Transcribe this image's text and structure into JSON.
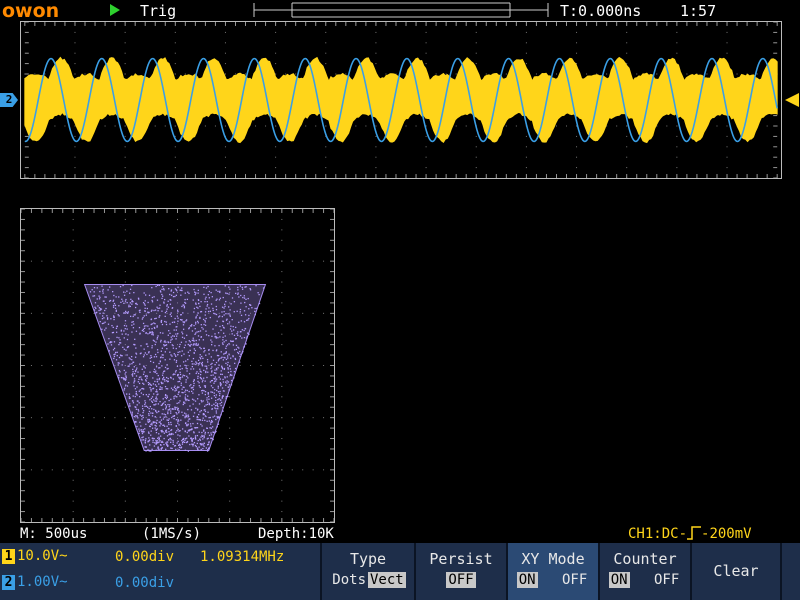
{
  "brand": "owon",
  "status": {
    "trigger_label": "Trig",
    "time_offset": "T:0.000ns",
    "clock": "1:57"
  },
  "markers": {
    "ch2_marker": "2"
  },
  "info": {
    "timebase": "M: 500us",
    "sample_rate": "(1MS/s)",
    "depth": "Depth:10K",
    "trigger_prefix": "CH1:DC-",
    "trigger_level": "-200mV"
  },
  "channels": [
    {
      "num": "1",
      "volts": "10.0V~",
      "offset": "0.00div",
      "freq": "1.09314MHz",
      "color": "#ffd51a"
    },
    {
      "num": "2",
      "volts": "1.00V~",
      "offset": "0.00div",
      "freq": "",
      "color": "#3a9fe6"
    }
  ],
  "menu": {
    "type": {
      "title": "Type",
      "opt_a": "Dots",
      "opt_b": "Vect"
    },
    "persist": {
      "title": "Persist",
      "value": "OFF"
    },
    "xy_mode": {
      "title": "XY Mode",
      "on": "ON",
      "off": "OFF"
    },
    "counter": {
      "title": "Counter",
      "on": "ON",
      "off": "OFF"
    },
    "clear": {
      "title": "Clear"
    }
  },
  "colors": {
    "ch1": "#ffd51a",
    "ch2": "#3a9fe6",
    "xy": "#a68cf0",
    "logo": "#ff8a00"
  }
}
